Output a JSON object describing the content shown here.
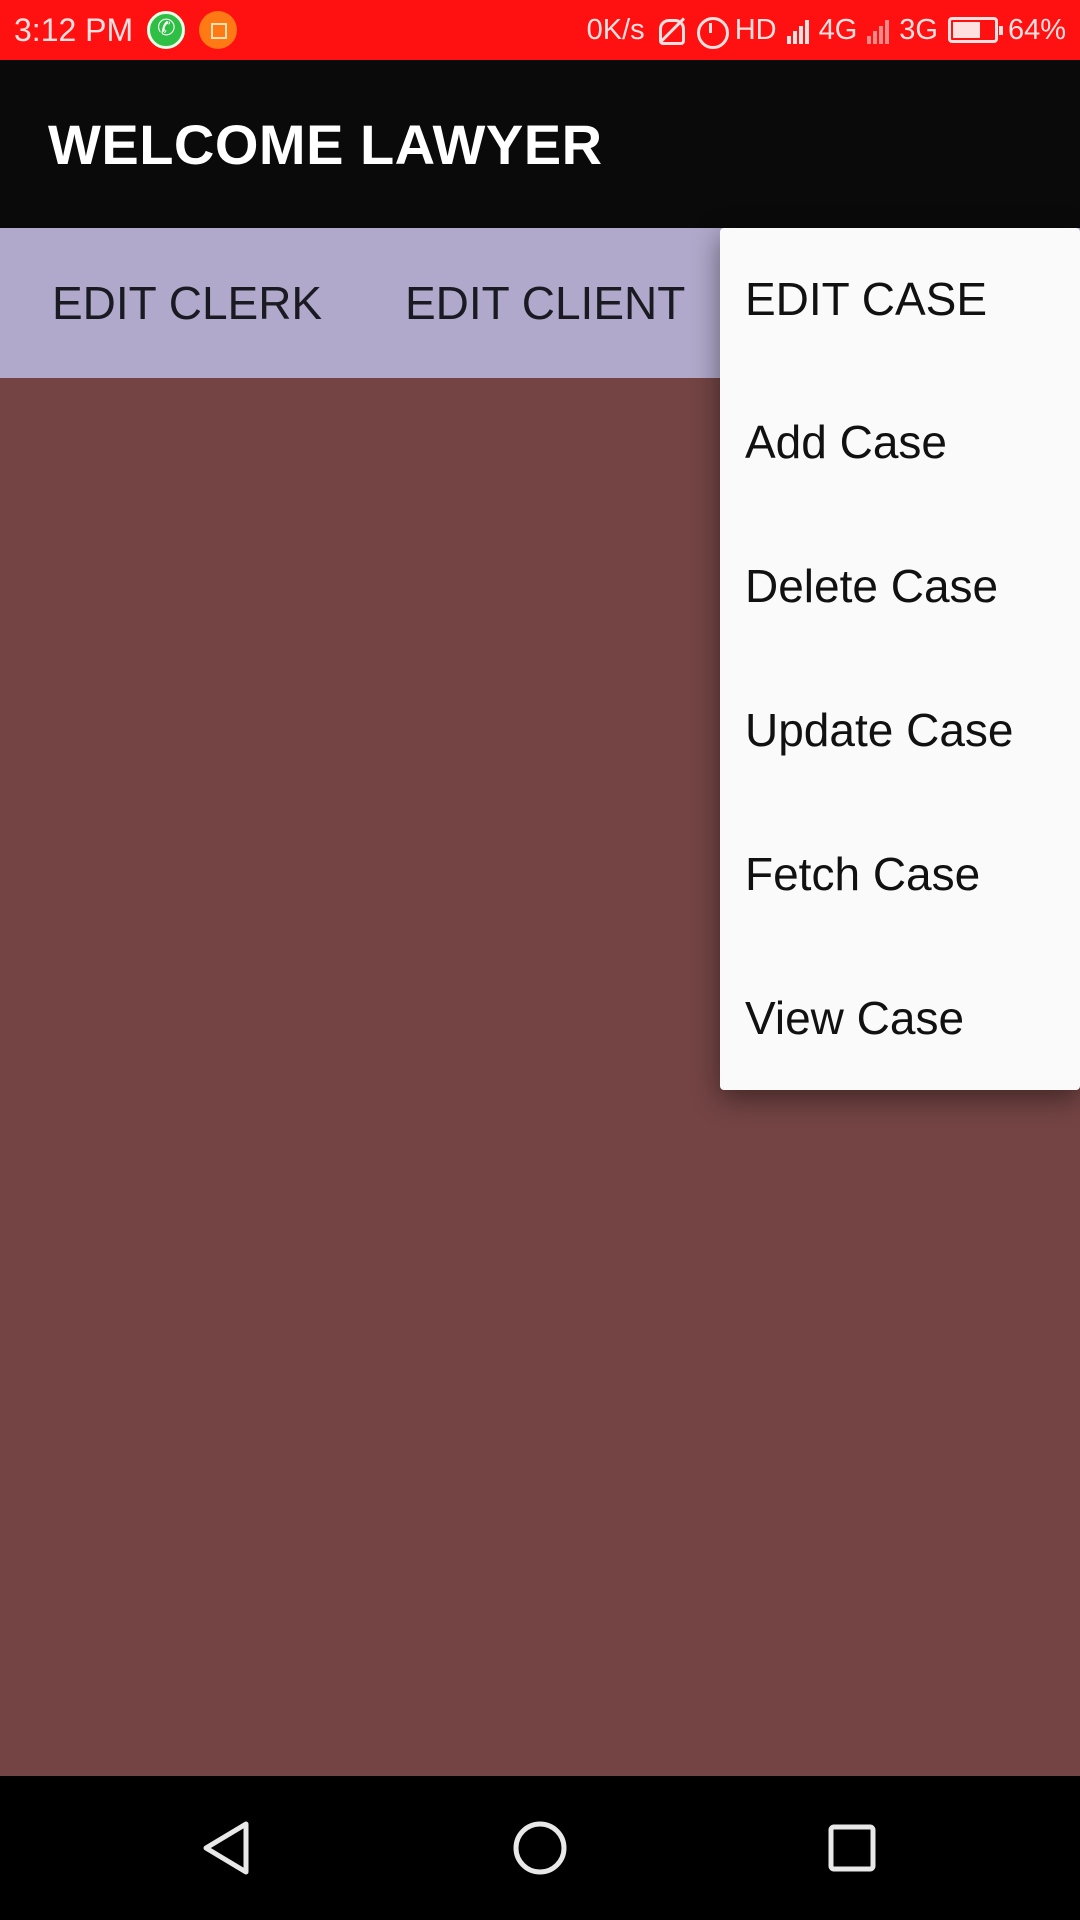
{
  "status_bar": {
    "time": "3:12 PM",
    "speed": "0K/s",
    "hd": "HD",
    "net1": "4G",
    "net2": "3G",
    "battery": "64%",
    "icons": [
      "whatsapp-icon",
      "crop-icon",
      "vibrate-off-icon",
      "alarm-icon",
      "signal-icon",
      "battery-icon"
    ]
  },
  "app_bar": {
    "title": "WELCOME LAWYER"
  },
  "tabs": [
    {
      "label": "EDIT CLERK"
    },
    {
      "label": "EDIT CLIENT"
    }
  ],
  "menu": {
    "items": [
      {
        "label": "EDIT CASE"
      },
      {
        "label": "Add Case"
      },
      {
        "label": "Delete Case"
      },
      {
        "label": "Update Case"
      },
      {
        "label": "Fetch Case"
      },
      {
        "label": "View Case"
      }
    ]
  },
  "nav_bar": {
    "icons": [
      "back-icon",
      "home-icon",
      "recents-icon"
    ]
  },
  "colors": {
    "status_bar": "#ff1111",
    "app_bar": "#0a0a0a",
    "tab_bar": "#b1a9cb",
    "content": "#744444",
    "menu": "#fafafa"
  }
}
